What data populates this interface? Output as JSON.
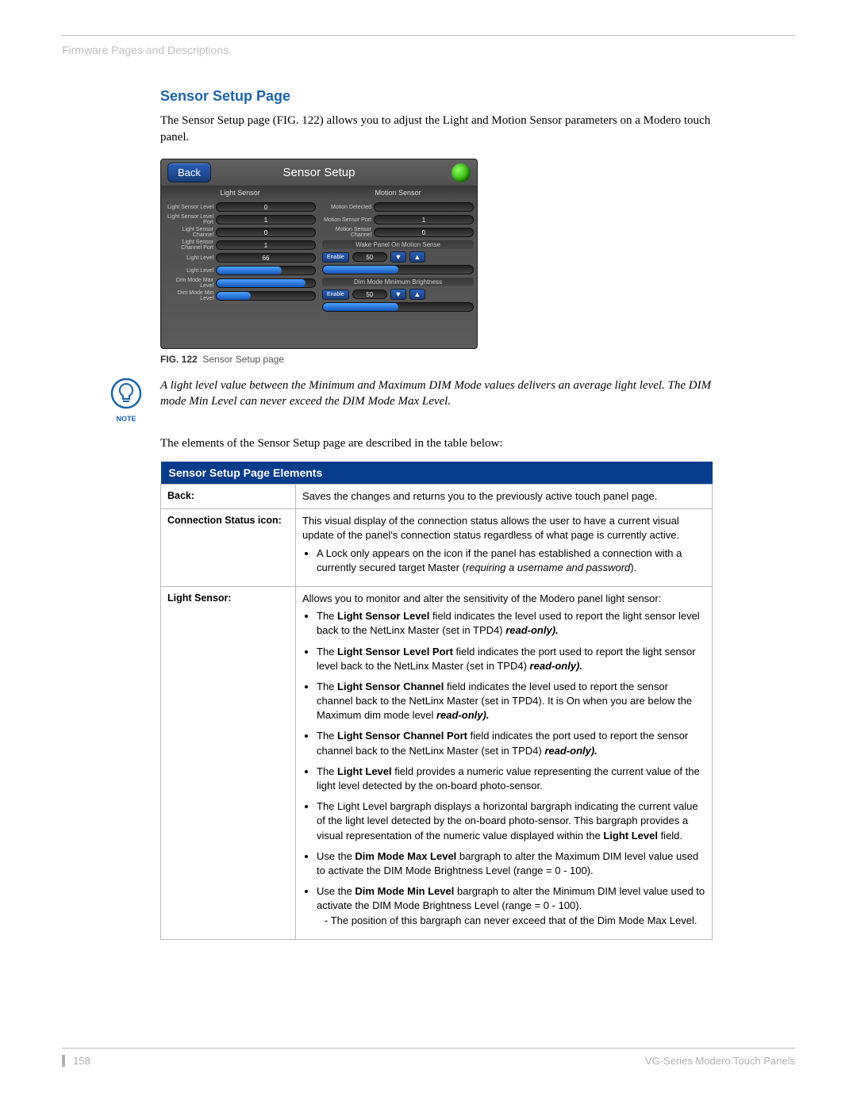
{
  "section_header": "Firmware Pages and Descriptions",
  "heading": "Sensor Setup Page",
  "intro": "The Sensor Setup page (FIG. 122) allows you to adjust the Light and Motion Sensor parameters on a Modero touch panel.",
  "panel": {
    "back": "Back",
    "title": "Sensor Setup",
    "col_left": "Light Sensor",
    "col_right": "Motion Sensor",
    "left_rows": [
      {
        "label": "Light Sensor Level",
        "val": "0"
      },
      {
        "label": "Light Sensor Level Port",
        "val": "1"
      },
      {
        "label": "Light Sensor Channel",
        "val": "0"
      },
      {
        "label": "Light Sensor Channel Port",
        "val": "1"
      },
      {
        "label": "Light Level",
        "val": "66"
      },
      {
        "label": "Light Level",
        "fill": 66
      },
      {
        "label": "Dim Mode Max Level",
        "fill": 90
      },
      {
        "label": "Dim Mode Min Level",
        "fill": 35
      }
    ],
    "right_rows": [
      {
        "label": "Motion Detected",
        "val": ""
      },
      {
        "label": "Motion Sensor Port",
        "val": "1"
      },
      {
        "label": "Motion Sensor Channel",
        "val": "0"
      }
    ],
    "wake_label": "Wake Panel On Motion Sense",
    "enable": "Enable",
    "wake_val": "50",
    "dim_min_label": "Dim Mode Minimum Brightness",
    "dim_min_val": "50"
  },
  "fig_num": "FIG. 122",
  "fig_caption": "Sensor Setup page",
  "note": "A light level value between the Minimum and Maximum DIM Mode values delivers an average light level. The DIM mode Min Level can never exceed the DIM Mode Max Level.",
  "note_label": "NOTE",
  "intro2": "The elements of the Sensor Setup page are described in the table below:",
  "table": {
    "title": "Sensor Setup Page Elements",
    "rows": {
      "back": {
        "label": "Back:",
        "text": "Saves the changes and returns you to the previously active touch panel page."
      },
      "conn": {
        "label": "Connection Status icon:",
        "text": "This visual display of the connection status allows the user to have a current visual update of the panel's connection status regardless of what page is currently active.",
        "bullet1a": "A Lock only appears on the icon if the panel has established a connection with a currently secured target Master (",
        "bullet1b": "requiring a username and password",
        "bullet1c": ")."
      },
      "light": {
        "label": "Light Sensor:",
        "text": "Allows you to monitor and alter the sensitivity of the Modero panel light sensor:",
        "b1a": "The ",
        "b1b": "Light Sensor Level",
        "b1c": " field indicates the level used to report the light sensor level back to the NetLinx Master (set in TPD4) ",
        "b1d": "read-only).",
        "b2a": "The ",
        "b2b": "Light Sensor Level Port",
        "b2c": " field indicates the port used to report the light sensor level back to the NetLinx Master (set in TPD4) ",
        "b2d": "read-only).",
        "b3a": "The ",
        "b3b": "Light Sensor Channel",
        "b3c": " field indicates the level used to report the sensor channel back to the NetLinx Master (set in TPD4). It is On when you are below the Maximum dim mode level ",
        "b3d": "read-only).",
        "b4a": "The ",
        "b4b": "Light Sensor Channel Port",
        "b4c": " field indicates the port used to report the sensor channel back to the NetLinx Master (set in TPD4) ",
        "b4d": "read-only).",
        "b5a": "The ",
        "b5b": "Light Level",
        "b5c": " field provides a numeric value representing the current value of the light level detected by the on-board photo-sensor.",
        "b6a": "The Light Level bargraph displays a horizontal bargraph indicating the current value of the light level detected by the on-board photo-sensor. This bargraph provides a visual representation of the numeric value displayed within the ",
        "b6b": "Light Level",
        "b6c": " field.",
        "b7a": "Use the ",
        "b7b": "Dim Mode Max Level",
        "b7c": " bargraph to alter the Maximum DIM level value used to activate the DIM Mode Brightness Level (range = 0 - 100).",
        "b8a": "Use the ",
        "b8b": "Dim Mode Min Level",
        "b8c": " bargraph to alter the Minimum DIM level value used to activate the DIM Mode Brightness Level (range = 0 - 100).",
        "b8sub": "- The position of this bargraph can never exceed that of the Dim Mode Max Level."
      }
    }
  },
  "footer": {
    "page": "158",
    "doc": "VG-Series Modero Touch Panels"
  }
}
